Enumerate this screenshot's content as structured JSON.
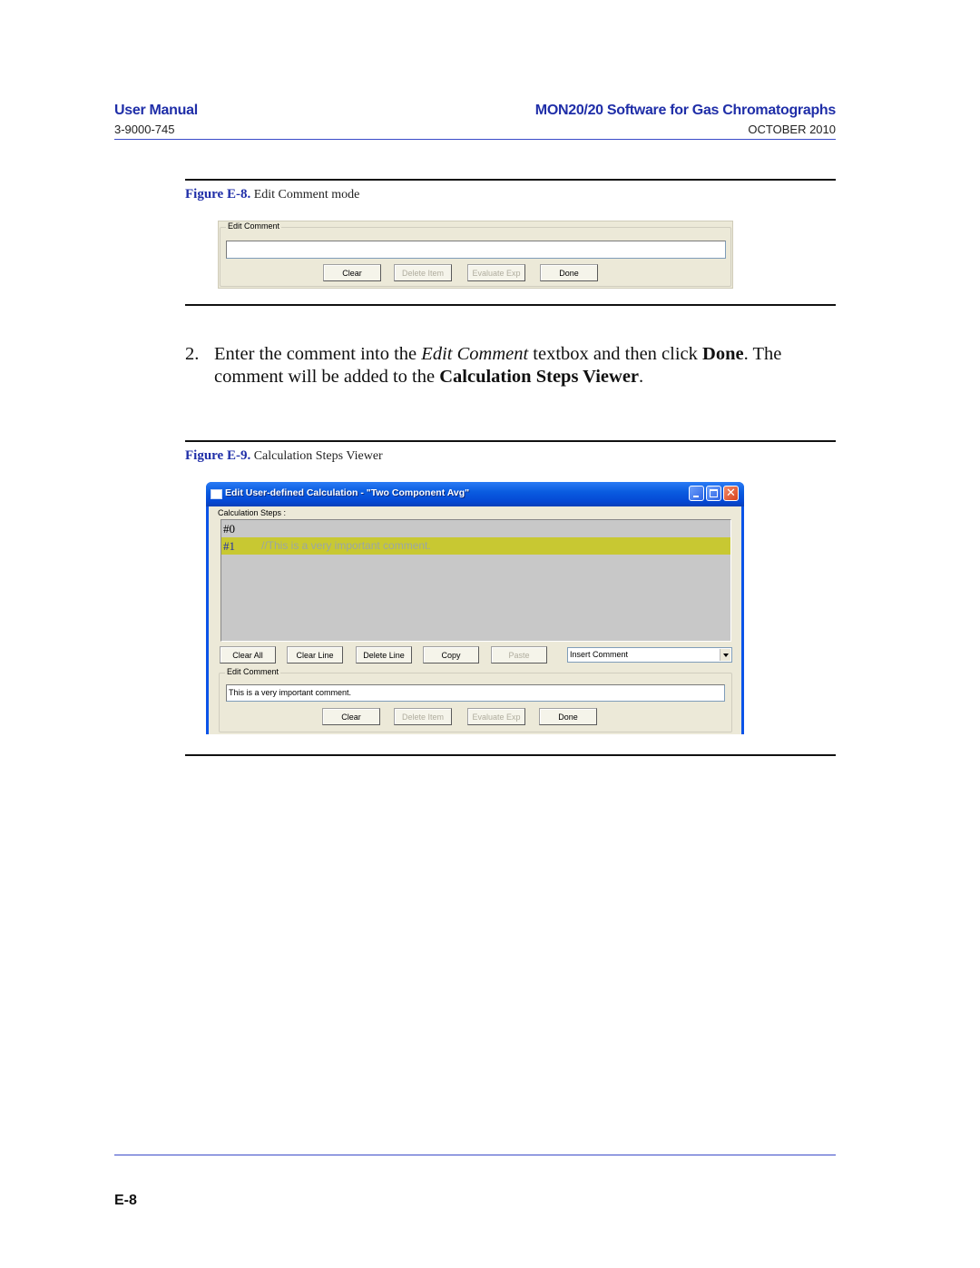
{
  "header": {
    "left_title": "User Manual",
    "left_subtitle": "3-9000-745",
    "right_title": "MON20/20 Software for Gas Chromatographs",
    "right_subtitle": "OCTOBER 2010"
  },
  "figure_e8": {
    "number": "Figure E-8.",
    "caption": "Edit Comment mode",
    "groupbox_label": "Edit Comment",
    "comment_value": "",
    "buttons": {
      "clear": "Clear",
      "delete_item": "Delete Item",
      "evaluate_exp": "Evaluate Exp",
      "done": "Done"
    }
  },
  "step2": {
    "number": "2.",
    "text_before_italic": "Enter the comment into the ",
    "italic": "Edit Comment",
    "text_after_italic": " textbox and then click ",
    "bold1": "Done",
    "text_mid": ".  The comment will be added to the ",
    "bold2": "Calculation Steps Viewer",
    "text_end": "."
  },
  "figure_e9": {
    "number": "Figure E-9.",
    "caption": "Calculation Steps Viewer",
    "window": {
      "title": "Edit User-defined Calculation - \"Two Component Avg\"",
      "close_glyph": "✕",
      "steps_label": "Calculation Steps :",
      "steps": [
        {
          "num": "#0",
          "text": "",
          "selected": false
        },
        {
          "num": "#1",
          "text": "//This is a very important comment.",
          "selected": true
        }
      ],
      "toolbar": {
        "clear_all": "Clear All",
        "clear_line": "Clear Line",
        "delete_line": "Delete Line",
        "copy": "Copy",
        "paste": "Paste",
        "insert_mode": "Insert Comment"
      },
      "edit_comment": {
        "label": "Edit Comment",
        "value": "This is a very important comment.",
        "clear": "Clear",
        "delete_item": "Delete Item",
        "evaluate_exp": "Evaluate Exp",
        "done": "Done"
      }
    }
  },
  "footer": {
    "page_number": "E-8"
  }
}
